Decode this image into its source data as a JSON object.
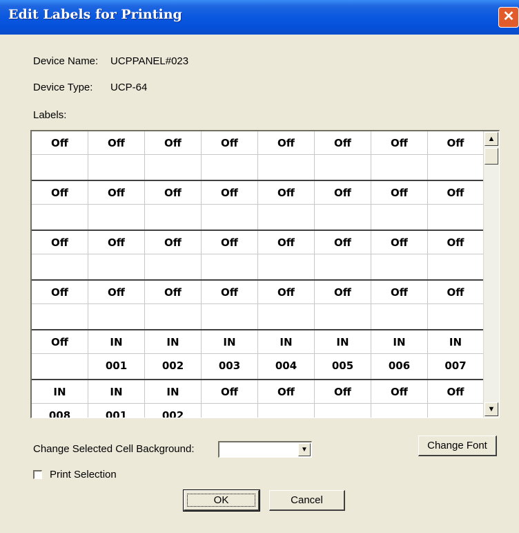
{
  "window": {
    "title": "Edit Labels for Printing",
    "close_glyph": "✕"
  },
  "device": {
    "name_label": "Device Name:",
    "name_value": "UCPPANEL#023",
    "type_label": "Device Type:",
    "type_value": "UCP-64"
  },
  "labels_heading": "Labels:",
  "grid": {
    "groups": [
      [
        [
          "Off",
          "Off",
          "Off",
          "Off",
          "Off",
          "Off",
          "Off",
          "Off"
        ],
        [
          "",
          "",
          "",
          "",
          "",
          "",
          "",
          ""
        ]
      ],
      [
        [
          "Off",
          "Off",
          "Off",
          "Off",
          "Off",
          "Off",
          "Off",
          "Off"
        ],
        [
          "",
          "",
          "",
          "",
          "",
          "",
          "",
          ""
        ]
      ],
      [
        [
          "Off",
          "Off",
          "Off",
          "Off",
          "Off",
          "Off",
          "Off",
          "Off"
        ],
        [
          "",
          "",
          "",
          "",
          "",
          "",
          "",
          ""
        ]
      ],
      [
        [
          "Off",
          "Off",
          "Off",
          "Off",
          "Off",
          "Off",
          "Off",
          "Off"
        ],
        [
          "",
          "",
          "",
          "",
          "",
          "",
          "",
          ""
        ]
      ],
      [
        [
          "Off",
          "IN",
          "IN",
          "IN",
          "IN",
          "IN",
          "IN",
          "IN"
        ],
        [
          "",
          "001",
          "002",
          "003",
          "004",
          "005",
          "006",
          "007"
        ]
      ],
      [
        [
          "IN",
          "IN",
          "IN",
          "Off",
          "Off",
          "Off",
          "Off",
          "Off"
        ],
        [
          "008",
          "001",
          "002",
          "",
          "",
          "",
          "",
          ""
        ]
      ]
    ],
    "scroll_up": "▲",
    "scroll_down": "▼"
  },
  "background": {
    "label": "Change Selected Cell Background:",
    "value": "",
    "arrow": "▼"
  },
  "buttons": {
    "change_font": "Change Font",
    "ok": "OK",
    "cancel": "Cancel"
  },
  "print_selection": {
    "label": "Print Selection",
    "checked": false
  },
  "colors": {
    "titlebar": "#0a58e0",
    "close": "#e25c2b",
    "dialog_bg": "#ece9d8"
  }
}
